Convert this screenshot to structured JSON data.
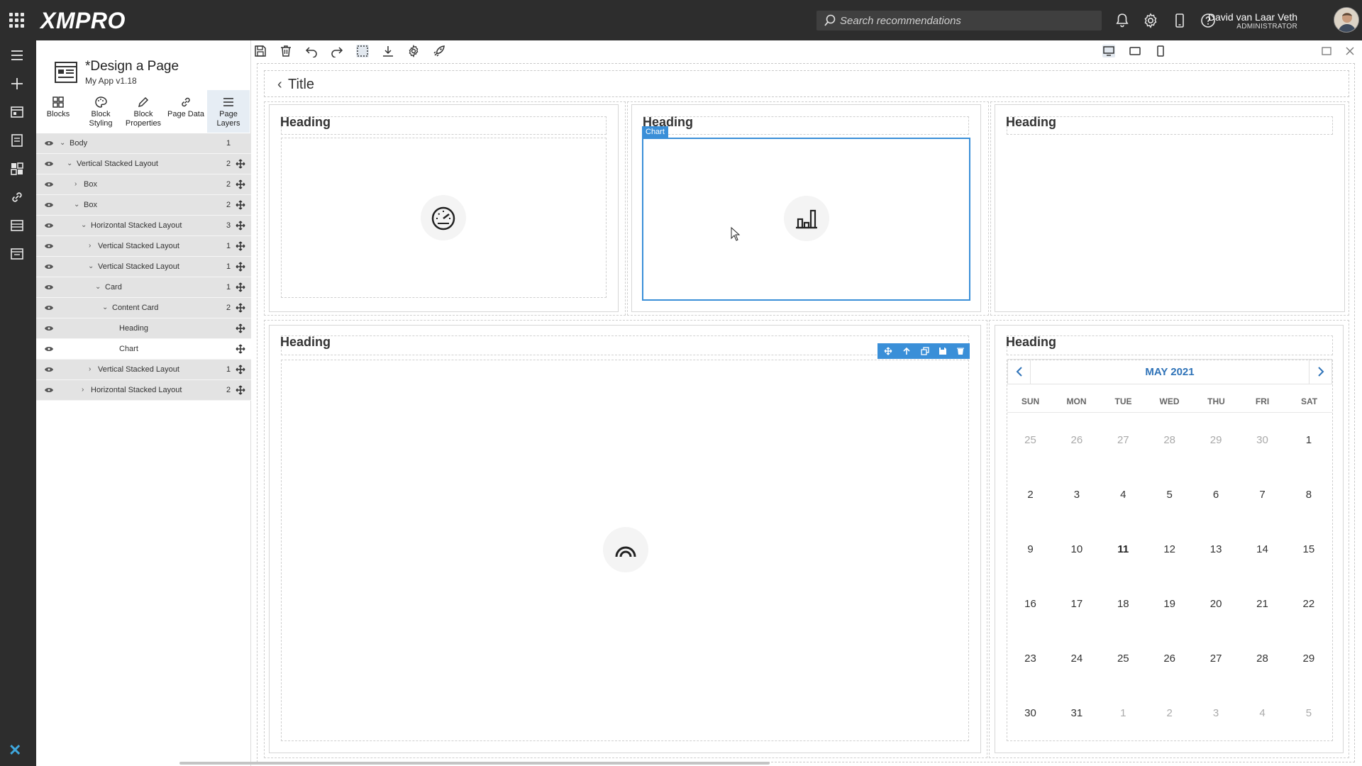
{
  "topbar": {
    "brand": "XMPRO",
    "search_placeholder": "Search recommendations",
    "user_name": "David van Laar Veth",
    "user_role": "ADMINISTRATOR"
  },
  "panel": {
    "page_title": "*Design a Page",
    "page_subtitle": "My App v1.18",
    "tabs": [
      {
        "label": "Blocks",
        "icon": "blocks-icon"
      },
      {
        "label": "Block Styling",
        "icon": "palette-icon"
      },
      {
        "label": "Block Properties",
        "icon": "pencil-icon"
      },
      {
        "label": "Page Data",
        "icon": "link-icon"
      },
      {
        "label": "Page Layers",
        "icon": "layers-icon"
      }
    ],
    "layers": [
      {
        "name": "Body",
        "count": "1",
        "expanded": "down"
      },
      {
        "name": "Vertical Stacked Layout",
        "count": "2",
        "expanded": "down"
      },
      {
        "name": "Box",
        "count": "2",
        "expanded": "right"
      },
      {
        "name": "Box",
        "count": "2",
        "expanded": "down"
      },
      {
        "name": "Horizontal Stacked Layout",
        "count": "3",
        "expanded": "down"
      },
      {
        "name": "Vertical Stacked Layout",
        "count": "1",
        "expanded": "right"
      },
      {
        "name": "Vertical Stacked Layout",
        "count": "1",
        "expanded": "down"
      },
      {
        "name": "Card",
        "count": "1",
        "expanded": "down"
      },
      {
        "name": "Content Card",
        "count": "2",
        "expanded": "down"
      },
      {
        "name": "Heading",
        "count": "",
        "expanded": "none"
      },
      {
        "name": "Chart",
        "count": "",
        "expanded": "none"
      },
      {
        "name": "Vertical Stacked Layout",
        "count": "1",
        "expanded": "right"
      },
      {
        "name": "Horizontal Stacked Layout",
        "count": "2",
        "expanded": "right"
      }
    ]
  },
  "canvas": {
    "title": "Title",
    "headings": {
      "card1": "Heading",
      "card2": "Heading",
      "card3": "Heading",
      "card4": "Heading",
      "card5": "Heading"
    },
    "chart_tag": "Chart"
  },
  "calendar": {
    "month": "MAY 2021",
    "day_names": [
      "SUN",
      "MON",
      "TUE",
      "WED",
      "THU",
      "FRI",
      "SAT"
    ],
    "weeks": [
      [
        "25",
        "26",
        "27",
        "28",
        "29",
        "30",
        "1"
      ],
      [
        "2",
        "3",
        "4",
        "5",
        "6",
        "7",
        "8"
      ],
      [
        "9",
        "10",
        "11",
        "12",
        "13",
        "14",
        "15"
      ],
      [
        "16",
        "17",
        "18",
        "19",
        "20",
        "21",
        "22"
      ],
      [
        "23",
        "24",
        "25",
        "26",
        "27",
        "28",
        "29"
      ],
      [
        "30",
        "31",
        "1",
        "2",
        "3",
        "4",
        "5"
      ]
    ],
    "today": "11"
  },
  "colors": {
    "accent": "#3a8fd8",
    "topbar": "#2d2d2d",
    "month_text": "#2f73b8"
  }
}
